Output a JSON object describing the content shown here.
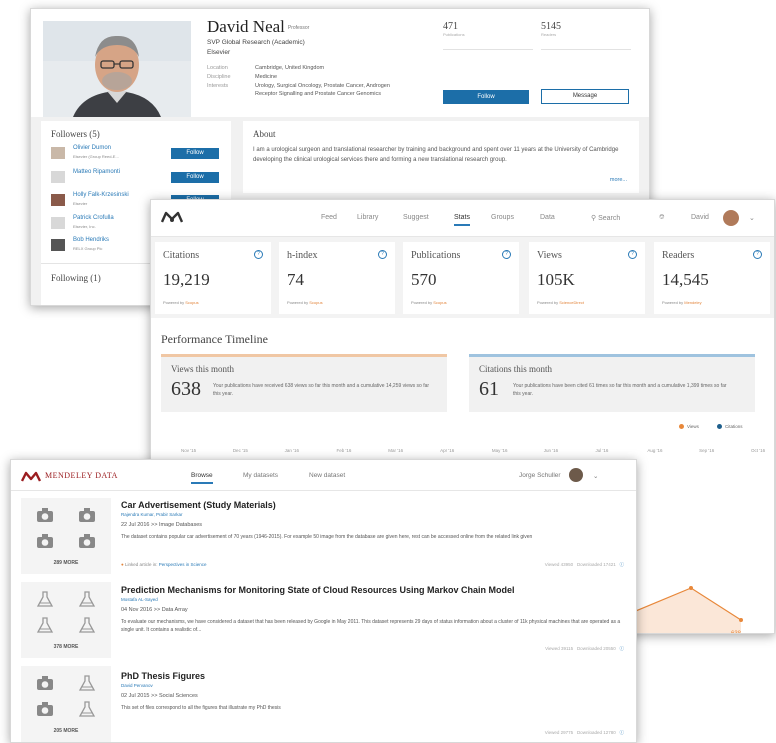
{
  "profile": {
    "name": "David Neal",
    "role": "Professor",
    "position": "SVP Global Research (Academic)",
    "org": "Elsevier",
    "fields": [
      {
        "key": "Location",
        "value": "Cambridge, United Kingdom"
      },
      {
        "key": "Discipline",
        "value": "Medicine"
      },
      {
        "key": "Interests",
        "value": "Urology, Surgical Oncology, Prostate Cancer, Androgen"
      },
      {
        "key": "",
        "value": "Receptor Signalling and Prostate Cancer Genomics"
      }
    ],
    "publications_count": "471",
    "publications_label": "Publications",
    "readers_count": "5145",
    "readers_label": "Readers",
    "follow_label": "Follow",
    "message_label": "Message",
    "followers_title": "Followers (5)",
    "followers": [
      {
        "name": "Olivier Dumon",
        "org": "Elsevier (Group Reed-E..."
      },
      {
        "name": "Matteo Ripamonti",
        "org": ""
      },
      {
        "name": "Holly Falk-Krzesinski",
        "org": "Elsevier"
      },
      {
        "name": "Patrick Crofulla",
        "org": "Elsevier, Inc."
      },
      {
        "name": "Bob Hendriks",
        "org": "RELX Group Plc"
      }
    ],
    "following_title": "Following (1)",
    "about_title": "About",
    "about_text": "I am a urological surgeon and translational researcher by training and background and spent over 11 years at the University of Cambridge developing the clinical urological services there and forming a new translational research group.",
    "more_label": "more..."
  },
  "stats_page": {
    "nav": [
      "Feed",
      "Library",
      "Suggest",
      "Stats",
      "Groups",
      "Data"
    ],
    "active_nav": "Stats",
    "search_label": "Search",
    "user_name": "David",
    "metrics": [
      {
        "label": "Citations",
        "value": "19,219",
        "powered": "Powered by",
        "source": "Scopus"
      },
      {
        "label": "h-index",
        "value": "74",
        "powered": "Powered by",
        "source": "Scopus"
      },
      {
        "label": "Publications",
        "value": "570",
        "powered": "Powered by",
        "source": "Scopus"
      },
      {
        "label": "Views",
        "value": "105K",
        "powered": "Powered by",
        "source": "ScienceDirect"
      },
      {
        "label": "Readers",
        "value": "14,545",
        "powered": "Powered by",
        "source": "Mendeley"
      }
    ],
    "timeline_title": "Performance Timeline",
    "views_month_title": "Views this month",
    "views_month_value": "638",
    "views_month_desc": "Your publications have received 638 views so far this month and a cumulative 14,259 views so far this year.",
    "citations_month_title": "Citations this month",
    "citations_month_value": "61",
    "citations_month_desc": "Your publications have been cited 61 times so far this month and a cumulative 1,399 times so far this year.",
    "legend_views": "Views",
    "legend_citations": "Citations",
    "months": [
      "Nov '15",
      "Dec '15",
      "Jan '16",
      "Feb '16",
      "Mar '16",
      "Apr '16",
      "May '16",
      "Jun '16",
      "Jul '16",
      "Aug '16",
      "Sep '16",
      "Oct '16"
    ],
    "point_views_label": "638",
    "point_citations_label": "61"
  },
  "colors": {
    "accent_blue": "#1c6ea8",
    "views_orange": "#e8883a",
    "citations_blue": "#1e5f8c",
    "mendeley_red": "#9b1d20"
  },
  "datasets_page": {
    "brand": "MENDELEY DATA",
    "nav": [
      "Browse",
      "My datasets",
      "New dataset"
    ],
    "user_name": "Jorge Schuller",
    "items": [
      {
        "title": "Car Advertisement (Study Materials)",
        "authors": "Rajendra Kumar, Prabir Sarkar",
        "date": "22 Jul 2016",
        "category": "Image Databases",
        "description": "The dataset contains popular car advertisement of 70 years (1946-2015). For example 50 image from the database are given here, rest can be accessed online from the related link given",
        "linked_prefix": "Linked article in:",
        "linked_journal": "Perspectives in Science",
        "viewed": "Viewed 43950",
        "downloaded": "Downloaded 17421",
        "more": "289 MORE"
      },
      {
        "title": "Prediction Mechanisms for Monitoring State of Cloud Resources Using Markov Chain Model",
        "authors": "Mostafa AL-Sayed",
        "date": "04 Nov 2016",
        "category": "Data Array",
        "description": "To evaluate our mechanisms, we have considered a dataset that has been released by Google in May 2011. This dataset represents 29 days of status information about a cluster of 11k physical machines that are operated as a single unit. It contains a realistic of...",
        "viewed": "Viewed 39115",
        "downloaded": "Downloaded 20550",
        "more": "378 MORE"
      },
      {
        "title": "PhD Thesis Figures",
        "authors": "David Pervanov",
        "date": "02 Jul 2015",
        "category": "Social Sciences",
        "description": "This set of files correspond to all the figures that illustrate my PhD thesis",
        "viewed": "Viewed 29775",
        "downloaded": "Downloaded 12780",
        "more": "205 MORE"
      }
    ]
  }
}
